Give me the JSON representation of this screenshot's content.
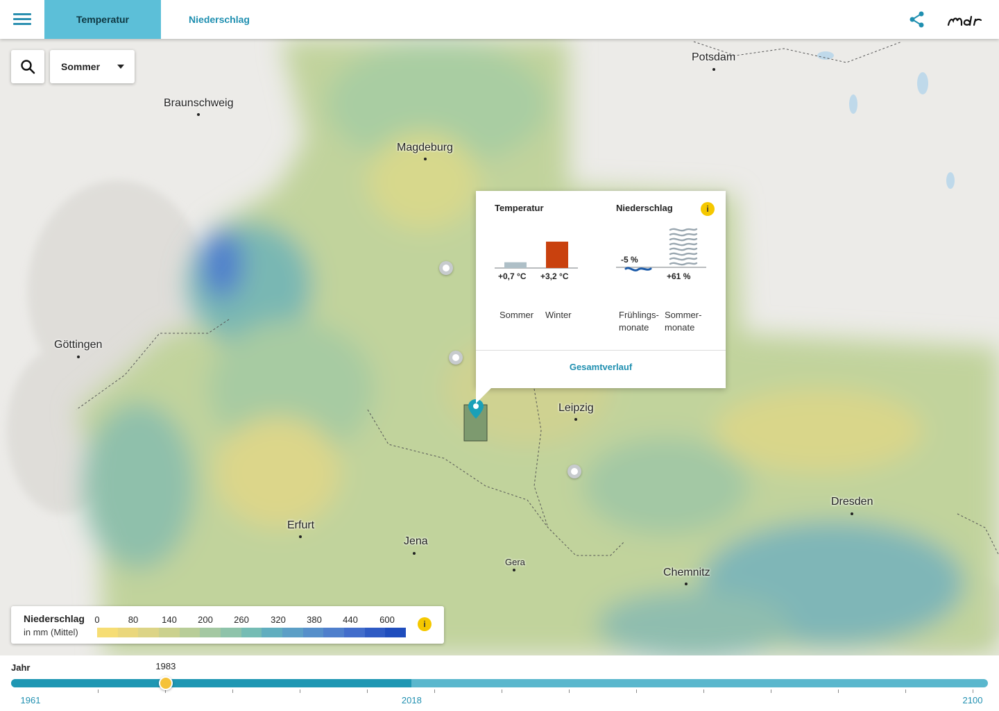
{
  "header": {
    "menu_icon": "hamburger-menu-icon",
    "tabs": [
      {
        "label": "Temperatur",
        "active": true
      },
      {
        "label": "Niederschlag",
        "active": false
      }
    ],
    "share_icon": "share-icon",
    "logo": "mdr"
  },
  "controls": {
    "search_icon": "search-icon",
    "season_select": {
      "value": "Sommer"
    }
  },
  "map": {
    "cities": [
      {
        "name": "Potsdam"
      },
      {
        "name": "Braunschweig"
      },
      {
        "name": "Magdeburg"
      },
      {
        "name": "Göttingen"
      },
      {
        "name": "Leipzig"
      },
      {
        "name": "Dresden"
      },
      {
        "name": "Erfurt"
      },
      {
        "name": "Jena"
      },
      {
        "name": "Gera"
      },
      {
        "name": "Chemnitz"
      }
    ]
  },
  "popup": {
    "temperature": {
      "heading": "Temperatur",
      "values": [
        "+0,7 °C",
        "+3,2 °C"
      ],
      "captions": [
        "Sommer",
        "Winter"
      ],
      "change_c": [
        0.7,
        3.2
      ]
    },
    "precipitation": {
      "heading": "Niederschlag",
      "values": [
        "-5 %",
        "+61 %"
      ],
      "captions": [
        [
          "Frühlings-",
          "monate"
        ],
        [
          "Sommer-",
          "monate"
        ]
      ],
      "change_percent": [
        -5,
        61
      ]
    },
    "info_icon": "info-icon",
    "link": "Gesamtverlauf"
  },
  "legend": {
    "title": "Niederschlag",
    "subtitle": "in mm (Mittel)",
    "ticks": [
      "0",
      "80",
      "140",
      "200",
      "260",
      "320",
      "380",
      "440",
      "600"
    ],
    "colors": [
      "#f6dd74",
      "#ead77c",
      "#dcd486",
      "#cbd18e",
      "#b8cd98",
      "#a4c8a2",
      "#8ec3aa",
      "#75bcb4",
      "#61aebf",
      "#5c9fc6",
      "#568fca",
      "#4f7fcc",
      "#426dcb",
      "#2f5bc4",
      "#1f4dbd"
    ],
    "info_icon": "info-icon"
  },
  "timeline": {
    "label": "Jahr",
    "current_year": "1983",
    "years": [
      "1961",
      "2018",
      "2100"
    ],
    "start": 1961,
    "split": 2018,
    "end": 2100,
    "current": 1983
  }
}
